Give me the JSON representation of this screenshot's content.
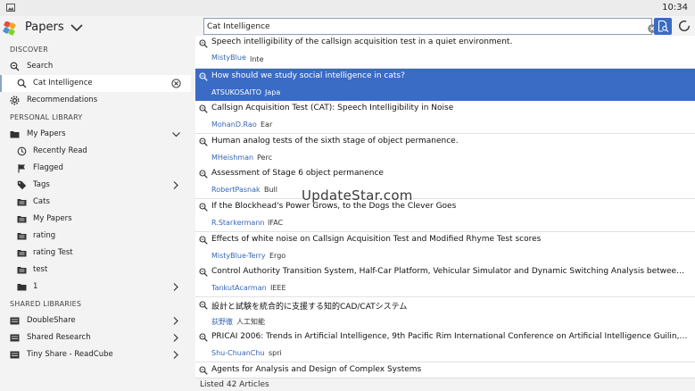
{
  "status_bar": {
    "time": "10:34"
  },
  "app": {
    "title": "Papers"
  },
  "sidebar": {
    "discover_label": "DISCOVER",
    "personal_label": "PERSONAL LIBRARY",
    "shared_label": "SHARED LIBRARIES",
    "search": "Search",
    "search_query": "Cat Intelligence",
    "recommendations": "Recommendations",
    "my_papers": "My Papers",
    "recently_read": "Recently Read",
    "flagged": "Flagged",
    "tags": "Tags",
    "cats": "Cats",
    "my_papers_folder": "My Papers",
    "rating": "rating",
    "rating_test": "rating Test",
    "test": "test",
    "one": "1",
    "double_share": "DoubleShare",
    "shared_research": "Shared Research",
    "tiny_share": "Tiny Share - ReadCube"
  },
  "search": {
    "value": "Cat Intelligence"
  },
  "results": [
    {
      "title": "Speech intelligibility of the callsign acquisition test in a quiet environment.",
      "author": "MistyBlue",
      "source": "Inte"
    },
    {
      "title": "How should we study social intelligence in cats?",
      "author": "ATSUKOSAITO",
      "source": "Japa"
    },
    {
      "title": "Callsign Acquisition Test (CAT): Speech Intelligibility in Noise",
      "author": "MohanD.Rao",
      "source": "Ear"
    },
    {
      "title": "Human analog tests of the sixth stage of object permanence.",
      "author": "MHeishman",
      "source": "Perc"
    },
    {
      "title": "Assessment of Stage 6 object permanence",
      "author": "RobertPasnak",
      "source": "Bull"
    },
    {
      "title": "If the Blockhead's Power Grows, to the Dogs the Clever Goes",
      "author": "R.Starkermann",
      "source": "IFAC"
    },
    {
      "title": "Effects of white noise on Callsign Acquisition Test and Modified Rhyme Test scores",
      "author": "MistyBlue-Terry",
      "source": "Ergo"
    },
    {
      "title": "Control Authority Transition System, Half-Car Platform, Vehicular Simulator and Dynamic Switching Analysis between...",
      "author": "TankutAcarman",
      "source": "IEEE"
    },
    {
      "title": "設計と試験を統合的に支援する知的CAD/CATシステム",
      "author": "荻野徹",
      "source": "人工知能"
    },
    {
      "title": "PRICAI 2006: Trends in Artificial Intelligence, 9th Pacific Rim International Conference on Artificial Intelligence Guilin, ...",
      "author": "Shu-ChuanChu",
      "source": "spri"
    },
    {
      "title": "Agents for Analysis and Design of Complex Systems",
      "author": "",
      "source": ""
    }
  ],
  "footer": {
    "count": "Listed 42 Articles"
  },
  "watermark": "UpdateStar.com",
  "colors": {
    "accent": "#3a6bc5",
    "author_link": "#3766b5",
    "sidebar_bg": "#f3f3f3"
  }
}
